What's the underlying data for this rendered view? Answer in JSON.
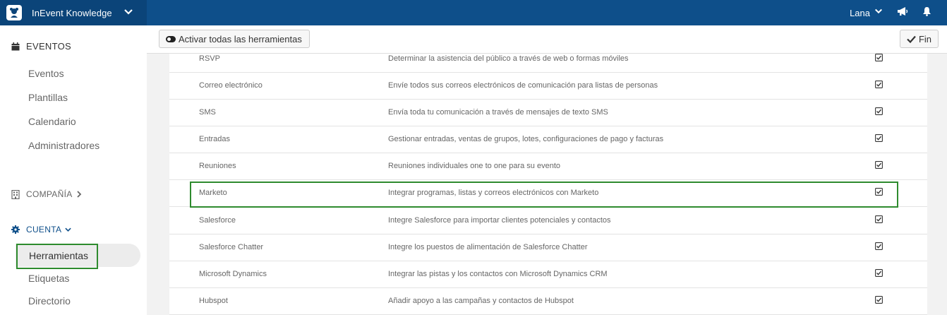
{
  "app": {
    "brand_name": "InEvent Knowledge"
  },
  "topbar": {
    "user_name": "Lana"
  },
  "sidebar": {
    "eventos_label": "EVENTOS",
    "eventos_items": [
      "Eventos",
      "Plantillas",
      "Calendario",
      "Administradores"
    ],
    "compania_label": "COMPAÑÍA",
    "cuenta_label": "CUENTA",
    "cuenta_items": [
      "Herramientas",
      "Etiquetas",
      "Directorio"
    ],
    "active_item": "Herramientas"
  },
  "toolbar": {
    "activate_all_label": "Activar todas las herramientas",
    "done_label": "Fin"
  },
  "tools": [
    {
      "name": "RSVP",
      "description": "Determinar la asistencia del público a través de web o formas móviles",
      "enabled": true
    },
    {
      "name": "Correo electrónico",
      "description": "Envíe todos sus correos electrónicos de comunicación para listas de personas",
      "enabled": true
    },
    {
      "name": "SMS",
      "description": "Envía toda tu comunicación a través de mensajes de texto SMS",
      "enabled": true
    },
    {
      "name": "Entradas",
      "description": "Gestionar entradas, ventas de grupos, lotes, configuraciones de pago y facturas",
      "enabled": true
    },
    {
      "name": "Reuniones",
      "description": "Reuniones individuales one to one para su evento",
      "enabled": true
    },
    {
      "name": "Marketo",
      "description": "Integrar programas, listas y correos electrónicos con Marketo",
      "enabled": true
    },
    {
      "name": "Salesforce",
      "description": "Integre Salesforce para importar clientes potenciales y contactos",
      "enabled": true
    },
    {
      "name": "Salesforce Chatter",
      "description": "Integre los puestos de alimentación de Salesforce Chatter",
      "enabled": true
    },
    {
      "name": "Microsoft Dynamics",
      "description": "Integrar las pistas y los contactos con Microsoft Dynamics CRM",
      "enabled": true
    },
    {
      "name": "Hubspot",
      "description": "Añadir apoyo a las campañas y contactos de Hubspot",
      "enabled": true
    }
  ],
  "highlighted_tool": "Marketo",
  "colors": {
    "topbar": "#0e4f8a",
    "brand_bar": "#0b4479",
    "highlight": "#2e8b2e"
  }
}
